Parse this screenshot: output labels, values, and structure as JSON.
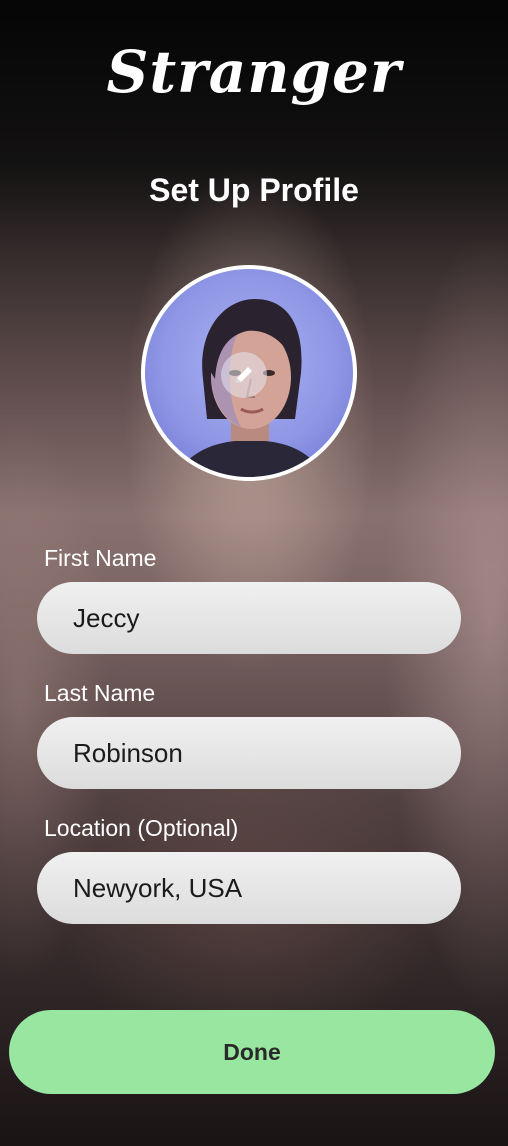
{
  "app": {
    "logo": "Stranger"
  },
  "header": {
    "title": "Set Up Profile"
  },
  "avatar": {
    "edit_icon": "pencil-icon"
  },
  "form": {
    "first_name": {
      "label": "First Name",
      "value": "Jeccy"
    },
    "last_name": {
      "label": "Last Name",
      "value": "Robinson"
    },
    "location": {
      "label": "Location (Optional)",
      "value": "Newyork, USA"
    }
  },
  "actions": {
    "done_label": "Done"
  },
  "colors": {
    "done_button": "#98e6a0",
    "field_background": "#e6e6e6",
    "text_on_background": "#ffffff"
  }
}
